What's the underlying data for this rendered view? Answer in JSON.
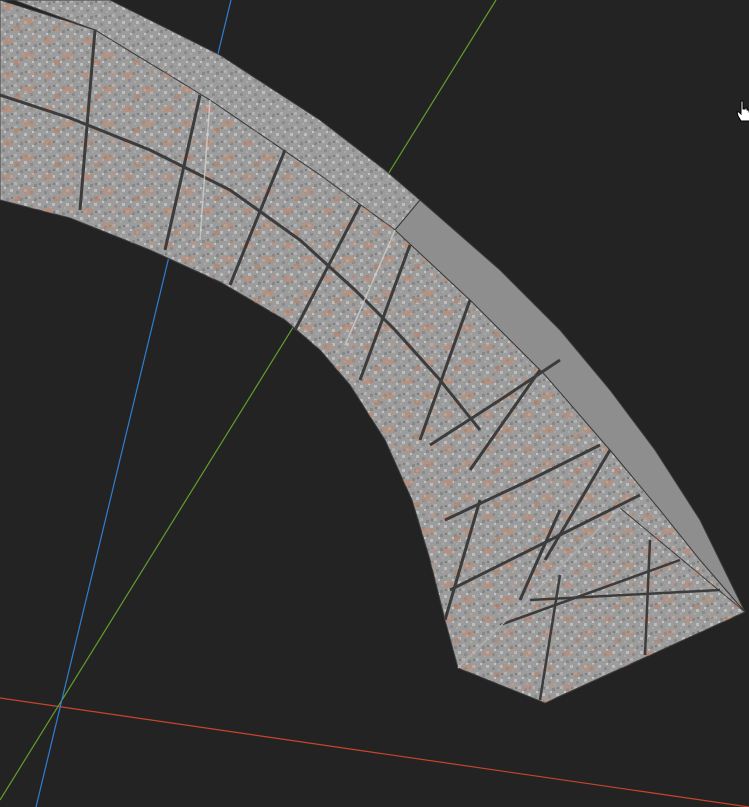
{
  "viewport": {
    "background": "#232323",
    "axis_colors": {
      "x_axis": "#c8452c",
      "y_axis": "#5f9e2f",
      "z_axis": "#2f7fd0"
    }
  },
  "model": {
    "material": "stone-brick",
    "stone_color": "#9c9c9c",
    "rust_color": "#c08a72",
    "mortar_color": "#3c3c3c"
  },
  "cursor": {
    "icon": "hand-pointer-icon"
  }
}
